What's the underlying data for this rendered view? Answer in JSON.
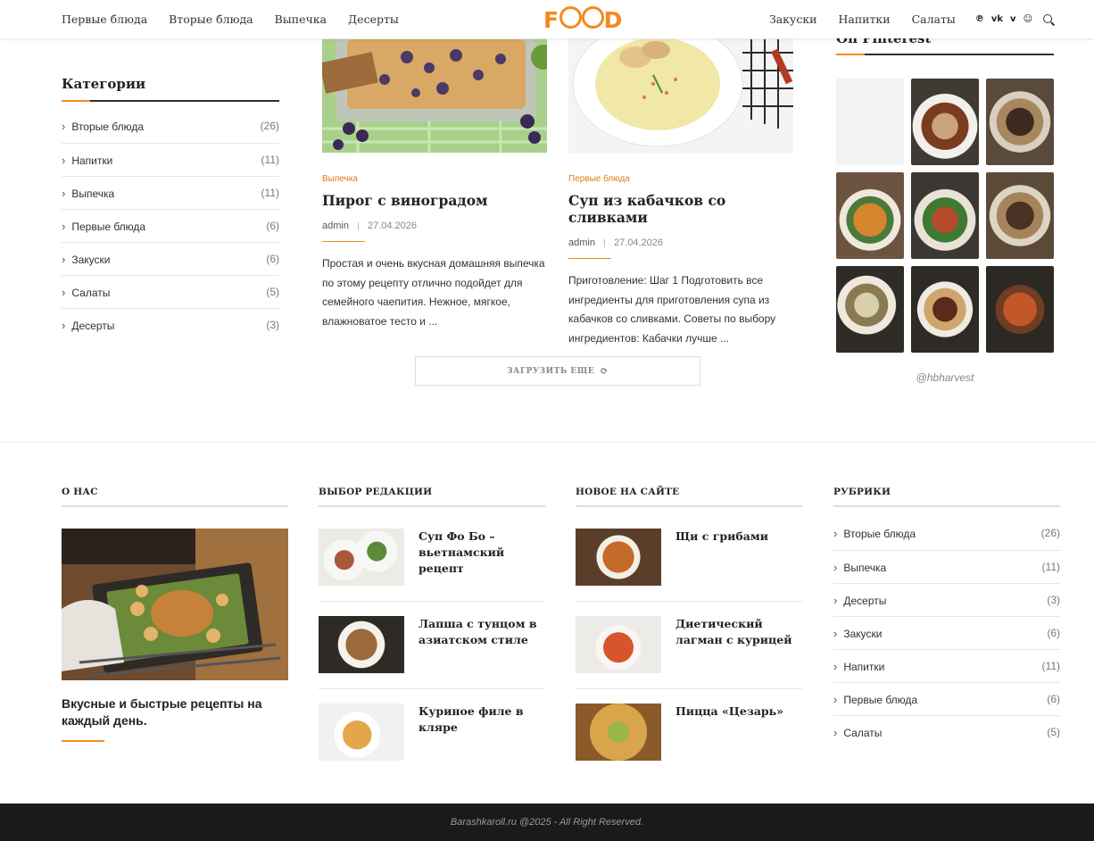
{
  "header": {
    "nav_left": [
      "Первые блюда",
      "Вторые блюда",
      "Выпечка",
      "Десерты"
    ],
    "logo": {
      "prefix": "F",
      "suffix": "D"
    },
    "nav_right": [
      "Закуски",
      "Напитки",
      "Салаты"
    ],
    "social_icons": [
      "pinterest-icon",
      "vk-icon",
      "vimeo-icon",
      "reddit-icon"
    ],
    "social_glyphs": [
      "℗",
      "vk",
      "v",
      "☺"
    ]
  },
  "sidebar": {
    "title": "Категории",
    "items": [
      {
        "label": "Вторые блюда",
        "count": "(26)"
      },
      {
        "label": "Напитки",
        "count": "(11)"
      },
      {
        "label": "Выпечка",
        "count": "(11)"
      },
      {
        "label": "Первые блюда",
        "count": "(6)"
      },
      {
        "label": "Закуски",
        "count": "(6)"
      },
      {
        "label": "Салаты",
        "count": "(5)"
      },
      {
        "label": "Десерты",
        "count": "(3)"
      }
    ]
  },
  "posts": [
    {
      "category": "Выпечка",
      "title": "Пирог с виноградом",
      "author": "admin",
      "date": "27.04.2026",
      "excerpt": "Простая и очень вкусная домашняя выпечка по этому рецепту отлично подойдет для семейного чаепития. Нежное, мягкое, влажноватое тесто и ..."
    },
    {
      "category": "Первые блюда",
      "title": "Суп из кабачков со сливками",
      "author": "admin",
      "date": "27.04.2026",
      "excerpt": "Приготовление: Шаг 1 Подготовить все ингредиенты для приготовления супа из кабачков со сливками. Советы по выбору ингредиентов: Кабачки лучше ..."
    }
  ],
  "load_more": {
    "label": "ЗАГРУЗИТЬ ЕЩЕ",
    "icon": "⟳"
  },
  "pinterest": {
    "title": "On Pinterest",
    "user": "@hbharvest"
  },
  "footer": {
    "about": {
      "title": "О НАС",
      "text": "Вкусные и быстрые рецепты на каждый день."
    },
    "editors": {
      "title": "ВЫБОР РЕДАКЦИИ",
      "items": [
        "Суп Фо Бо – вьетнамский рецепт",
        "Лапша с тунцом в азиатском стиле",
        "Куриное филе в кляре"
      ]
    },
    "new": {
      "title": "НОВОЕ НА САЙТЕ",
      "items": [
        "Щи с грибами",
        "Диетический лагман с курицей",
        "Пицца «Цезарь»"
      ]
    },
    "rubrics": {
      "title": "РУБРИКИ",
      "items": [
        {
          "label": "Вторые блюда",
          "count": "(26)"
        },
        {
          "label": "Выпечка",
          "count": "(11)"
        },
        {
          "label": "Десерты",
          "count": "(3)"
        },
        {
          "label": "Закуски",
          "count": "(6)"
        },
        {
          "label": "Напитки",
          "count": "(11)"
        },
        {
          "label": "Первые блюда",
          "count": "(6)"
        },
        {
          "label": "Салаты",
          "count": "(5)"
        }
      ]
    }
  },
  "copyright": "Barashkaroll.ru @2025 - All Right Reserved.",
  "colors": {
    "accent": "#f18b1d",
    "text": "#313131",
    "footer_bg": "#1a1a1a"
  }
}
